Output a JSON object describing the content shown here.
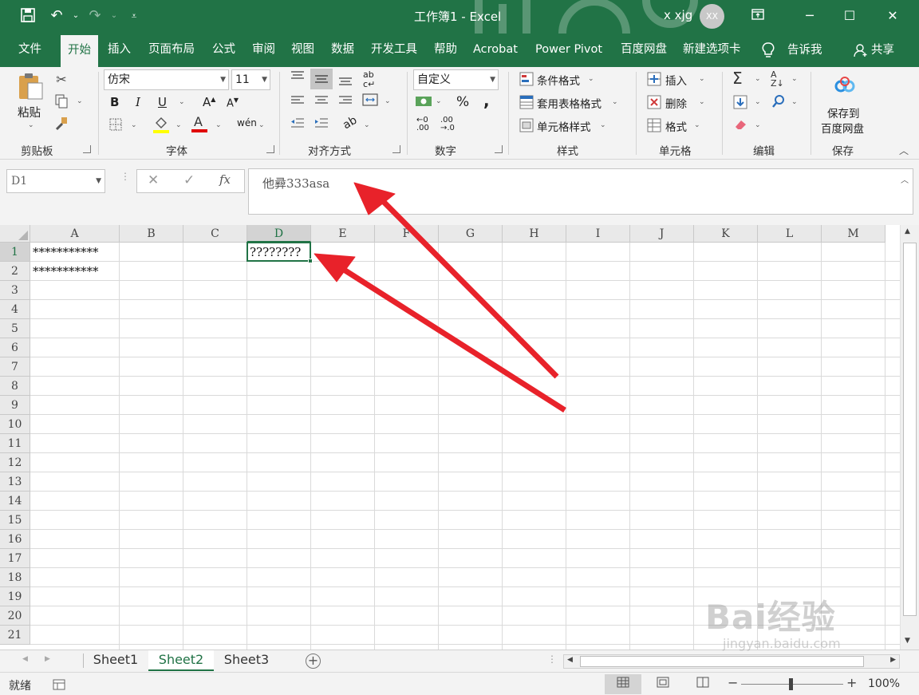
{
  "window": {
    "title": "工作簿1 - Excel",
    "user": "x xjg",
    "avatar_initials": "XX"
  },
  "quick_access": {
    "icons": [
      "save-icon",
      "undo-icon",
      "redo-icon",
      "customize-icon"
    ]
  },
  "menu": {
    "tabs": [
      "文件",
      "开始",
      "插入",
      "页面布局",
      "公式",
      "审阅",
      "视图",
      "数据",
      "开发工具",
      "帮助",
      "Acrobat",
      "Power Pivot",
      "百度网盘",
      "新建选项卡"
    ],
    "active": "开始",
    "tell_me": "告诉我",
    "share": "共享"
  },
  "ribbon": {
    "clipboard": {
      "paste": "粘贴",
      "label": "剪贴板"
    },
    "font": {
      "name": "仿宋",
      "size": "11",
      "label": "字体"
    },
    "alignment": {
      "label": "对齐方式"
    },
    "number": {
      "format": "自定义",
      "label": "数字",
      "percent": "%",
      "comma": ","
    },
    "styles": {
      "conditional": "条件格式",
      "table": "套用表格格式",
      "cell": "单元格样式",
      "label": "样式"
    },
    "cells": {
      "insert": "插入",
      "delete": "删除",
      "format": "格式",
      "label": "单元格"
    },
    "editing": {
      "label": "编辑"
    },
    "save": {
      "line1": "保存到",
      "line2": "百度网盘",
      "label": "保存"
    }
  },
  "formula_bar": {
    "name_box": "D1",
    "fx": "fx",
    "content": "他彛333asa"
  },
  "grid": {
    "columns": [
      "A",
      "B",
      "C",
      "D",
      "E",
      "F",
      "G",
      "H",
      "I",
      "J",
      "K",
      "L",
      "M"
    ],
    "rows": [
      "1",
      "2",
      "3",
      "4",
      "5",
      "6",
      "7",
      "8",
      "9",
      "10",
      "11",
      "12",
      "13",
      "14",
      "15",
      "16",
      "17",
      "18",
      "19",
      "20",
      "21"
    ],
    "cells": {
      "A1": "***********",
      "A2": "***********",
      "D1": "????????"
    },
    "selected": "D1"
  },
  "sheets": {
    "tabs": [
      "Sheet1",
      "Sheet2",
      "Sheet3"
    ],
    "active": "Sheet2"
  },
  "status": {
    "ready": "就绪",
    "zoom": "100%"
  },
  "watermark": {
    "brand": "Bai经验",
    "url": "jingyan.baidu.com"
  },
  "colors": {
    "accent": "#217346",
    "arrow": "#e8222a"
  }
}
